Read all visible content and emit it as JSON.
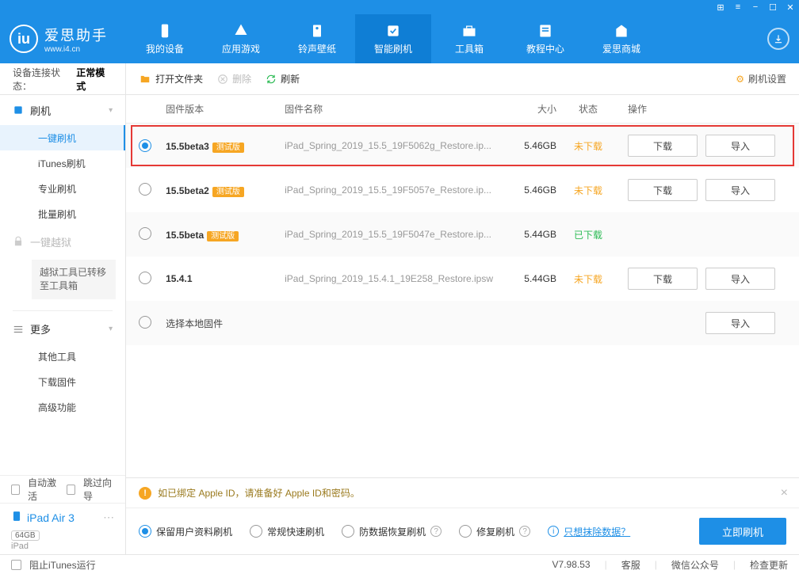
{
  "titlebar": {
    "ctrl_grid": "⊞",
    "ctrl_menu": "≡",
    "ctrl_min": "−",
    "ctrl_max": "☐",
    "ctrl_close": "✕"
  },
  "logo": {
    "badge": "iu",
    "name": "爱思助手",
    "url": "www.i4.cn"
  },
  "nav": [
    {
      "label": "我的设备"
    },
    {
      "label": "应用游戏"
    },
    {
      "label": "铃声壁纸"
    },
    {
      "label": "智能刷机",
      "active": true
    },
    {
      "label": "工具箱"
    },
    {
      "label": "教程中心"
    },
    {
      "label": "爱思商城"
    }
  ],
  "sidebar": {
    "conn_label": "设备连接状态：",
    "conn_value": "正常模式",
    "flash_head": "刷机",
    "items1": [
      {
        "label": "一键刷机",
        "active": true
      },
      {
        "label": "iTunes刷机"
      },
      {
        "label": "专业刷机"
      },
      {
        "label": "批量刷机"
      }
    ],
    "jailbreak_head": "一键越狱",
    "jailbreak_note": "越狱工具已转移至工具箱",
    "more_head": "更多",
    "items2": [
      {
        "label": "其他工具"
      },
      {
        "label": "下载固件"
      },
      {
        "label": "高级功能"
      }
    ],
    "auto_activate": "自动激活",
    "skip_guide": "跳过向导",
    "device_name": "iPad Air 3",
    "device_storage": "64GB",
    "device_type": "iPad",
    "dots": "⋯"
  },
  "toolbar": {
    "open": "打开文件夹",
    "delete": "删除",
    "refresh": "刷新",
    "settings": "刷机设置"
  },
  "columns": {
    "version": "固件版本",
    "name": "固件名称",
    "size": "大小",
    "status": "状态",
    "ops": "操作"
  },
  "beta_badge": "测试版",
  "btn_download": "下载",
  "btn_import": "导入",
  "status_not": "未下载",
  "status_done": "已下载",
  "firmware": [
    {
      "ver": "15.5beta3",
      "beta": true,
      "name": "iPad_Spring_2019_15.5_19F5062g_Restore.ip...",
      "size": "5.46GB",
      "status": "not",
      "selected": true,
      "highlight": true
    },
    {
      "ver": "15.5beta2",
      "beta": true,
      "name": "iPad_Spring_2019_15.5_19F5057e_Restore.ip...",
      "size": "5.46GB",
      "status": "not"
    },
    {
      "ver": "15.5beta",
      "beta": true,
      "name": "iPad_Spring_2019_15.5_19F5047e_Restore.ip...",
      "size": "5.44GB",
      "status": "done"
    },
    {
      "ver": "15.4.1",
      "beta": false,
      "name": "iPad_Spring_2019_15.4.1_19E258_Restore.ipsw",
      "size": "5.44GB",
      "status": "not"
    }
  ],
  "local_row": "选择本地固件",
  "warning": "如已绑定 Apple ID，请准备好 Apple ID和密码。",
  "options": {
    "o1": "保留用户资料刷机",
    "o2": "常规快速刷机",
    "o3": "防数据恢复刷机",
    "o4": "修复刷机",
    "erase_link": "只想抹除数据？"
  },
  "flash_button": "立即刷机",
  "statusbar": {
    "block_itunes": "阻止iTunes运行",
    "version": "V7.98.53",
    "support": "客服",
    "wechat": "微信公众号",
    "update": "检查更新"
  }
}
